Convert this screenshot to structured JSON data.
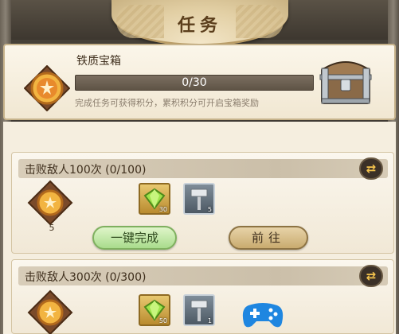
{
  "title": "任务",
  "chest": {
    "name": "铁质宝箱",
    "progress_current": 0,
    "progress_max": 30,
    "progress_text": "0/30",
    "hint": "完成任务可获得积分，累积积分可开启宝箱奖励",
    "icon": "iron-chest-icon"
  },
  "tasks": [
    {
      "title": "击败敌人100次 (0/100)",
      "medal_count": "5",
      "rewards": [
        {
          "icon": "green-gem-icon",
          "count": "30"
        },
        {
          "icon": "hammer-icon",
          "count": "5"
        }
      ],
      "complete_label": "一键完成",
      "go_label": "前往"
    },
    {
      "title": "击败敌人300次 (0/300)",
      "rewards": [
        {
          "icon": "green-gem-icon",
          "count": "50"
        },
        {
          "icon": "hammer-icon",
          "count": "1"
        }
      ]
    }
  ],
  "colors": {
    "accent_gold": "#e09a20",
    "complete_green": "#a9dc8c",
    "panel_bg": "#f5eedf"
  }
}
